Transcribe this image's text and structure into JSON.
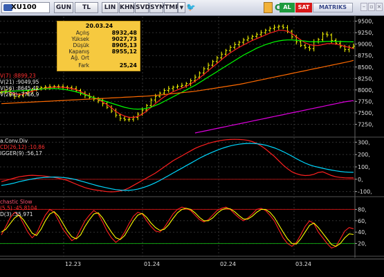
{
  "toolbar": {
    "symbol": "XU100",
    "buttons": [
      "GUN",
      "TL",
      "LIN",
      "KHN",
      "SVD",
      "SYM",
      "TMP"
    ],
    "buy": "AL",
    "sell": "SAT",
    "brand": "MATRIKS"
  },
  "info": {
    "date": "20.03.24",
    "rows": [
      {
        "label": "Açılış",
        "value": "8932,48"
      },
      {
        "label": "Yüksek",
        "value": "9027,73"
      },
      {
        "label": "Düşük",
        "value": "8905,13"
      },
      {
        "label": "Kapanış",
        "value": "8955,12"
      },
      {
        "label": "Ağ. Ort",
        "value": ""
      },
      {
        "label": "Fark",
        "value": "25,24"
      }
    ]
  },
  "legends": {
    "main": [
      "V(7)      :8899,23",
      "V(21)     :9049,95",
      "V(56)     :8645,42",
      "V(200)    :7766,9"
    ],
    "macd": [
      "a.Conv.Div",
      "CD(26,12)  :10,86",
      "IGGER(9)   :56,17"
    ],
    "stoch": [
      "chastic Slow",
      "(5,5)      :45,8104",
      "D(3)       :35,971"
    ]
  },
  "colors": {
    "background": "#000000",
    "up_bar": "#ffff00",
    "ma_short": "#ff2020",
    "ma_mid": "#00ff00",
    "ma_long": "#ff6a00",
    "ma_200": "#e000e0",
    "macd": "#ff2020",
    "trigger": "#00d8ff",
    "axis": "#333333"
  },
  "chart_data": [
    {
      "type": "line",
      "title": "XU100",
      "ylim": [
        7000,
        9600
      ],
      "y_ticks": [
        "9500,",
        "9250,",
        "9000,",
        "8750,",
        "8500,",
        "8250,",
        "8000,",
        "7750,",
        "7500,",
        "7250,"
      ],
      "x_ticks": [
        "12.23",
        "01.24",
        "02.24",
        "03.24"
      ],
      "series": [
        {
          "name": "ohlc-close",
          "values": [
            7950,
            7980,
            7900,
            7860,
            7880,
            7920,
            7970,
            8000,
            8030,
            8050,
            8060,
            8070,
            8075,
            8070,
            8060,
            8050,
            8030,
            7990,
            7930,
            7880,
            7840,
            7800,
            7760,
            7700,
            7620,
            7540,
            7450,
            7380,
            7350,
            7360,
            7400,
            7470,
            7560,
            7660,
            7780,
            7860,
            7930,
            7990,
            8030,
            8060,
            8080,
            8100,
            8140,
            8200,
            8280,
            8370,
            8460,
            8540,
            8620,
            8700,
            8780,
            8860,
            8930,
            8990,
            9040,
            9090,
            9130,
            9170,
            9210,
            9250,
            9300,
            9340,
            9370,
            9390,
            9360,
            9280,
            9160,
            9050,
            8970,
            8930,
            8900,
            9050,
            9100,
            9220,
            9200,
            9080,
            9020,
            8950,
            8880,
            8930,
            8955
          ]
        },
        {
          "name": "ma7",
          "values": [
            7980,
            7970,
            7950,
            7920,
            7900,
            7910,
            7940,
            7970,
            8000,
            8020,
            8040,
            8050,
            8060,
            8060,
            8055,
            8045,
            8030,
            8005,
            7965,
            7915,
            7870,
            7830,
            7790,
            7740,
            7680,
            7610,
            7530,
            7470,
            7430,
            7400,
            7400,
            7420,
            7470,
            7540,
            7620,
            7700,
            7780,
            7850,
            7910,
            7960,
            8000,
            8040,
            8080,
            8130,
            8190,
            8260,
            8340,
            8420,
            8500,
            8580,
            8660,
            8740,
            8810,
            8870,
            8930,
            8980,
            9030,
            9080,
            9120,
            9160,
            9200,
            9240,
            9270,
            9300,
            9300,
            9280,
            9230,
            9160,
            9090,
            9030,
            8990,
            8970,
            8970,
            8990,
            9010,
            9010,
            9000,
            8980,
            8950,
            8930,
            8900
          ]
        },
        {
          "name": "ma21",
          "values": [
            7960,
            7965,
            7970,
            7975,
            7980,
            7985,
            7990,
            8000,
            8010,
            8020,
            8025,
            8030,
            8030,
            8025,
            8015,
            8000,
            7980,
            7960,
            7930,
            7895,
            7860,
            7830,
            7800,
            7770,
            7740,
            7710,
            7680,
            7650,
            7620,
            7600,
            7585,
            7580,
            7585,
            7600,
            7625,
            7660,
            7700,
            7750,
            7800,
            7850,
            7900,
            7950,
            8000,
            8050,
            8100,
            8160,
            8220,
            8280,
            8340,
            8400,
            8460,
            8520,
            8580,
            8640,
            8700,
            8760,
            8810,
            8860,
            8910,
            8950,
            8990,
            9020,
            9050,
            9070,
            9085,
            9090,
            9090,
            9085,
            9075,
            9065,
            9055,
            9050,
            9050,
            9055,
            9060,
            9062,
            9060,
            9058,
            9055,
            9052,
            9050
          ]
        },
        {
          "name": "ma56",
          "values": [
            7700,
            7705,
            7710,
            7715,
            7720,
            7725,
            7730,
            7735,
            7740,
            7745,
            7750,
            7755,
            7760,
            7765,
            7770,
            7775,
            7780,
            7785,
            7790,
            7795,
            7800,
            7805,
            7810,
            7815,
            7820,
            7825,
            7830,
            7835,
            7840,
            7845,
            7850,
            7855,
            7860,
            7865,
            7870,
            7880,
            7890,
            7900,
            7910,
            7920,
            7930,
            7940,
            7950,
            7960,
            7970,
            7985,
            8000,
            8015,
            8030,
            8045,
            8060,
            8075,
            8090,
            8105,
            8120,
            8140,
            8160,
            8180,
            8200,
            8220,
            8240,
            8260,
            8280,
            8300,
            8320,
            8340,
            8360,
            8380,
            8400,
            8420,
            8440,
            8460,
            8480,
            8500,
            8520,
            8540,
            8560,
            8580,
            8600,
            8620,
            8645
          ]
        },
        {
          "name": "ma200",
          "values": [
            null,
            null,
            null,
            null,
            null,
            null,
            null,
            null,
            null,
            null,
            null,
            null,
            null,
            null,
            null,
            null,
            null,
            null,
            null,
            null,
            null,
            null,
            null,
            null,
            null,
            null,
            null,
            null,
            null,
            null,
            null,
            null,
            null,
            null,
            null,
            null,
            null,
            null,
            null,
            null,
            null,
            null,
            null,
            null,
            7060,
            7080,
            7100,
            7120,
            7140,
            7160,
            7180,
            7200,
            7220,
            7240,
            7260,
            7280,
            7300,
            7320,
            7340,
            7360,
            7380,
            7400,
            7420,
            7440,
            7460,
            7480,
            7500,
            7520,
            7540,
            7560,
            7580,
            7600,
            7620,
            7640,
            7660,
            7680,
            7700,
            7720,
            7740,
            7755,
            7767
          ]
        }
      ]
    },
    {
      "type": "line",
      "title": "a.Conv.Div",
      "ylim": [
        -130,
        330
      ],
      "y_ticks": [
        "300,",
        "200,",
        "100,",
        "0,",
        "-100,"
      ],
      "series": [
        {
          "name": "MACD(26,12)",
          "values": [
            -20,
            -10,
            0,
            10,
            20,
            25,
            30,
            32,
            30,
            28,
            24,
            20,
            15,
            8,
            0,
            -10,
            -25,
            -40,
            -55,
            -68,
            -78,
            -85,
            -90,
            -95,
            -100,
            -102,
            -100,
            -95,
            -85,
            -70,
            -50,
            -30,
            -10,
            10,
            30,
            50,
            75,
            100,
            125,
            150,
            170,
            190,
            210,
            230,
            250,
            265,
            278,
            290,
            300,
            308,
            315,
            320,
            322,
            323,
            322,
            320,
            315,
            305,
            290,
            270,
            245,
            215,
            185,
            150,
            115,
            85,
            60,
            45,
            35,
            30,
            32,
            40,
            55,
            60,
            45,
            30,
            20,
            15,
            12,
            11,
            11
          ]
        },
        {
          "name": "TRIGGER(9)",
          "values": [
            -50,
            -45,
            -38,
            -30,
            -20,
            -12,
            -5,
            2,
            8,
            12,
            15,
            17,
            18,
            17,
            14,
            10,
            4,
            -4,
            -14,
            -24,
            -34,
            -44,
            -54,
            -62,
            -70,
            -78,
            -84,
            -88,
            -90,
            -90,
            -86,
            -80,
            -70,
            -58,
            -44,
            -28,
            -10,
            10,
            30,
            50,
            70,
            90,
            110,
            130,
            150,
            170,
            188,
            205,
            220,
            235,
            248,
            260,
            270,
            278,
            284,
            288,
            290,
            290,
            288,
            283,
            276,
            266,
            254,
            240,
            224,
            206,
            187,
            167,
            148,
            131,
            116,
            105,
            97,
            89,
            81,
            74,
            68,
            63,
            59,
            57,
            56
          ]
        }
      ]
    },
    {
      "type": "line",
      "title": "chastic Slow",
      "ylim": [
        0,
        100
      ],
      "y_ticks": [
        "80,",
        "60,",
        "40,",
        "20,"
      ],
      "series": [
        {
          "name": "%K(5,5)",
          "values": [
            35,
            50,
            65,
            75,
            70,
            55,
            40,
            30,
            38,
            55,
            70,
            80,
            75,
            60,
            45,
            35,
            25,
            30,
            45,
            60,
            70,
            78,
            72,
            58,
            42,
            30,
            22,
            28,
            40,
            55,
            68,
            75,
            72,
            60,
            50,
            42,
            40,
            48,
            60,
            72,
            80,
            84,
            82,
            78,
            70,
            62,
            58,
            62,
            70,
            78,
            82,
            84,
            80,
            72,
            65,
            60,
            65,
            72,
            80,
            82,
            78,
            70,
            60,
            45,
            30,
            20,
            15,
            22,
            35,
            50,
            60,
            55,
            40,
            30,
            20,
            12,
            15,
            28,
            42,
            48,
            46
          ]
        },
        {
          "name": "%D(3)",
          "values": [
            40,
            45,
            55,
            65,
            70,
            62,
            50,
            38,
            34,
            45,
            60,
            72,
            76,
            68,
            55,
            42,
            32,
            28,
            35,
            50,
            62,
            72,
            74,
            65,
            52,
            40,
            30,
            27,
            34,
            47,
            60,
            70,
            73,
            66,
            56,
            48,
            43,
            45,
            53,
            64,
            74,
            80,
            82,
            80,
            74,
            66,
            60,
            60,
            65,
            73,
            79,
            82,
            81,
            76,
            69,
            63,
            63,
            68,
            75,
            80,
            80,
            75,
            66,
            53,
            40,
            28,
            20,
            19,
            28,
            40,
            52,
            56,
            48,
            38,
            28,
            18,
            15,
            20,
            30,
            37,
            36
          ]
        }
      ]
    }
  ]
}
